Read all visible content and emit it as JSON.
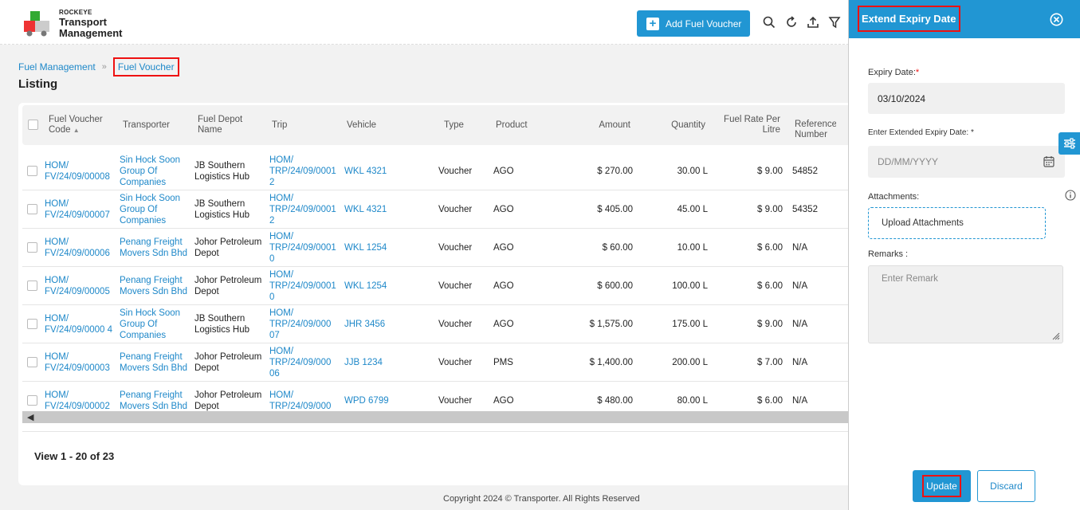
{
  "brand": {
    "small": "ROCKEYE",
    "line1": "Transport",
    "line2": "Management"
  },
  "header": {
    "add_button": "Add Fuel Voucher",
    "icons": [
      "search-icon",
      "refresh-icon",
      "upload-icon",
      "filter-icon"
    ]
  },
  "breadcrumb": {
    "parent": "Fuel Management",
    "current": "Fuel Voucher"
  },
  "page_title": "Listing",
  "table": {
    "headers": {
      "code": "Fuel Voucher Code",
      "transporter": "Transporter",
      "depot": "Fuel Depot Name",
      "trip": "Trip",
      "vehicle": "Vehicle",
      "type": "Type",
      "product": "Product",
      "amount": "Amount",
      "quantity": "Quantity",
      "rate": "Fuel Rate Per Litre",
      "reference": "Reference Number"
    },
    "rows": [
      {
        "code": "HOM/ FV/24/09/00008",
        "transporter": "Sin Hock Soon Group Of Companies",
        "depot": "JB Southern Logistics Hub",
        "trip": "HOM/ TRP/24/09/0001 2",
        "vehicle": "WKL 4321",
        "type": "Voucher",
        "product": "AGO",
        "amount": "$ 270.00",
        "quantity": "30.00 L",
        "rate": "$ 9.00",
        "reference": "54852"
      },
      {
        "code": "HOM/ FV/24/09/00007",
        "transporter": "Sin Hock Soon Group Of Companies",
        "depot": "JB Southern Logistics Hub",
        "trip": "HOM/ TRP/24/09/0001 2",
        "vehicle": "WKL 4321",
        "type": "Voucher",
        "product": "AGO",
        "amount": "$ 405.00",
        "quantity": "45.00 L",
        "rate": "$ 9.00",
        "reference": "54352"
      },
      {
        "code": "HOM/ FV/24/09/00006",
        "transporter": "Penang Freight Movers Sdn Bhd",
        "depot": "Johor Petroleum Depot",
        "trip": "HOM/ TRP/24/09/0001 0",
        "vehicle": "WKL 1254",
        "type": "Voucher",
        "product": "AGO",
        "amount": "$ 60.00",
        "quantity": "10.00 L",
        "rate": "$ 6.00",
        "reference": "N/A"
      },
      {
        "code": "HOM/ FV/24/09/00005",
        "transporter": "Penang Freight Movers Sdn Bhd",
        "depot": "Johor Petroleum Depot",
        "trip": "HOM/ TRP/24/09/0001 0",
        "vehicle": "WKL 1254",
        "type": "Voucher",
        "product": "AGO",
        "amount": "$ 600.00",
        "quantity": "100.00 L",
        "rate": "$ 6.00",
        "reference": "N/A"
      },
      {
        "code": "HOM/ FV/24/09/0000 4",
        "transporter": "Sin Hock Soon Group Of Companies",
        "depot": "JB Southern Logistics Hub",
        "trip": "HOM/ TRP/24/09/000 07",
        "vehicle": "JHR 3456",
        "type": "Voucher",
        "product": "AGO",
        "amount": "$ 1,575.00",
        "quantity": "175.00 L",
        "rate": "$ 9.00",
        "reference": "N/A"
      },
      {
        "code": "HOM/ FV/24/09/00003",
        "transporter": "Penang Freight Movers Sdn Bhd",
        "depot": "Johor Petroleum Depot",
        "trip": "HOM/ TRP/24/09/000 06",
        "vehicle": "JJB 1234",
        "type": "Voucher",
        "product": "PMS",
        "amount": "$ 1,400.00",
        "quantity": "200.00 L",
        "rate": "$ 7.00",
        "reference": "N/A"
      },
      {
        "code": "HOM/ FV/24/09/00002",
        "transporter": "Penang Freight Movers Sdn Bhd",
        "depot": "Johor Petroleum Depot",
        "trip": "HOM/ TRP/24/09/000",
        "vehicle": "WPD 6799",
        "type": "Voucher",
        "product": "AGO",
        "amount": "$ 480.00",
        "quantity": "80.00 L",
        "rate": "$ 6.00",
        "reference": "N/A"
      }
    ],
    "view_count": "View 1 - 20 of 23"
  },
  "footer": {
    "copyright": "Copyright 2024 © Transporter. All Rights Reserved"
  },
  "panel": {
    "title": "Extend Expiry Date",
    "expiry_label": "Expiry Date:",
    "expiry_value": "03/10/2024",
    "extended_label": "Enter Extended Expiry Date:",
    "extended_placeholder": "DD/MM/YYYY",
    "attachments_label": "Attachments:",
    "upload_label": "Upload Attachments",
    "remarks_label": "Remarks :",
    "remarks_placeholder": "Enter Remark",
    "update_button": "Update",
    "discard_button": "Discard"
  },
  "colors": {
    "primary": "#2196d3",
    "highlight": "#ee1111",
    "link": "#1e88c9"
  }
}
